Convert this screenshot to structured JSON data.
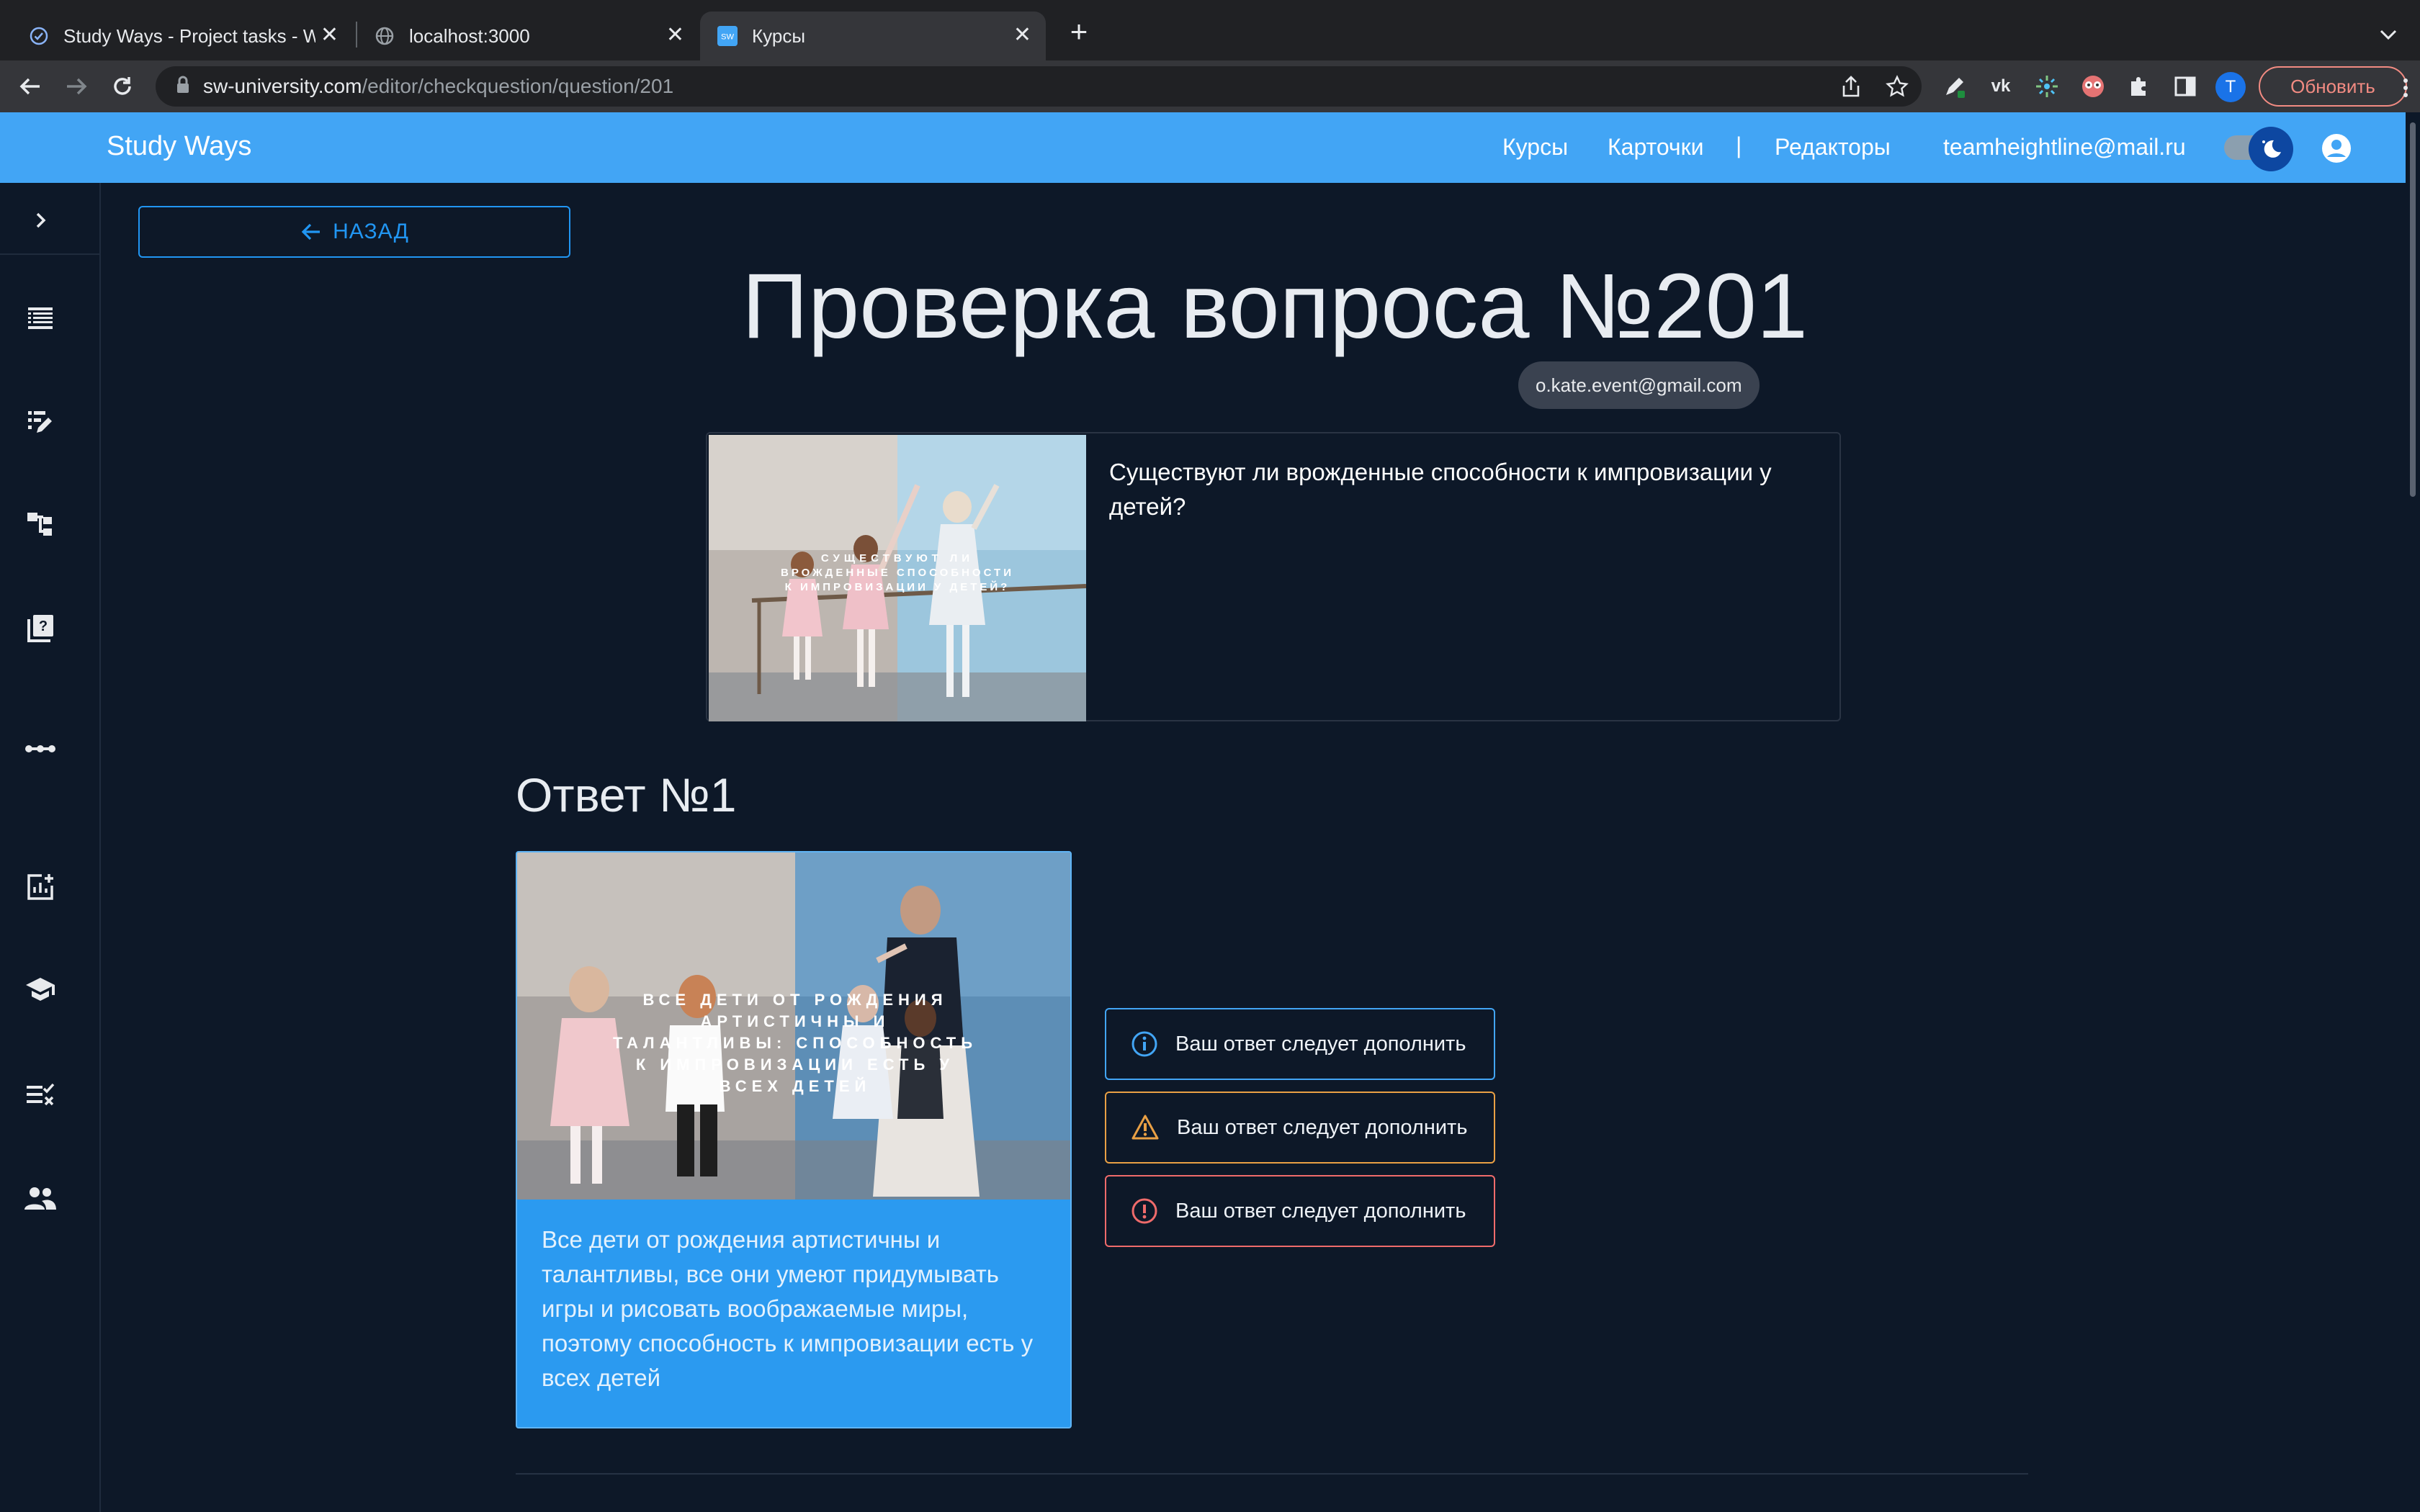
{
  "browser": {
    "tabs": [
      {
        "title": "Study Ways - Project tasks - W",
        "active": false
      },
      {
        "title": "localhost:3000",
        "active": false
      },
      {
        "title": "Курсы",
        "active": true
      }
    ],
    "url_host": "sw-university.com",
    "url_path": "/editor/checkquestion/question/201",
    "profile_initial": "T",
    "update_label": "Обновить",
    "vk_label": "vk",
    "sw_badge": "SW"
  },
  "header": {
    "brand": "Study Ways",
    "nav": [
      {
        "label": "Курсы"
      },
      {
        "label": "Карточки"
      },
      {
        "label": "Редакторы"
      }
    ],
    "divider": "|",
    "email": "teamheightline@mail.ru",
    "accent": "#42a5f5"
  },
  "sidebar": {
    "items": [
      {
        "icon": "chevron-right-icon"
      },
      {
        "icon": "list-view-icon"
      },
      {
        "icon": "edit-note-icon"
      },
      {
        "icon": "hierarchy-icon"
      },
      {
        "icon": "quiz-book-icon"
      },
      {
        "icon": "more-dots-icon"
      },
      {
        "icon": "add-chart-icon"
      },
      {
        "icon": "school-cap-icon"
      },
      {
        "icon": "checklist-icon"
      },
      {
        "icon": "people-icon"
      }
    ]
  },
  "main": {
    "back_label": "НАЗАД",
    "title": "Проверка вопроса №201",
    "author": "o.kate.event@gmail.com",
    "question": {
      "text": "Существуют ли врожденные способности к импровизации у детей?",
      "image_caption": "Существуют ли врожденные способности к импровизации у детей?"
    },
    "answer": {
      "heading": "Ответ №1",
      "image_caption": "Все дети от рождения артистичны и талантливы: способность к импровизации есть у всех детей",
      "text": "Все дети от рождения артистичны и талантливы, все они умеют придумывать игры и рисовать воображаемые миры, поэтому способность к импровизации есть у всех детей",
      "card_color": "#2b9af0"
    },
    "alerts": [
      {
        "type": "info",
        "text": "Ваш ответ следует дополнить",
        "color": "#42a5f5"
      },
      {
        "type": "warning",
        "text": "Ваш ответ следует дополнить",
        "color": "#e9a045"
      },
      {
        "type": "error",
        "text": "Ваш ответ следует дополнить",
        "color": "#ef6b6b"
      }
    ]
  }
}
